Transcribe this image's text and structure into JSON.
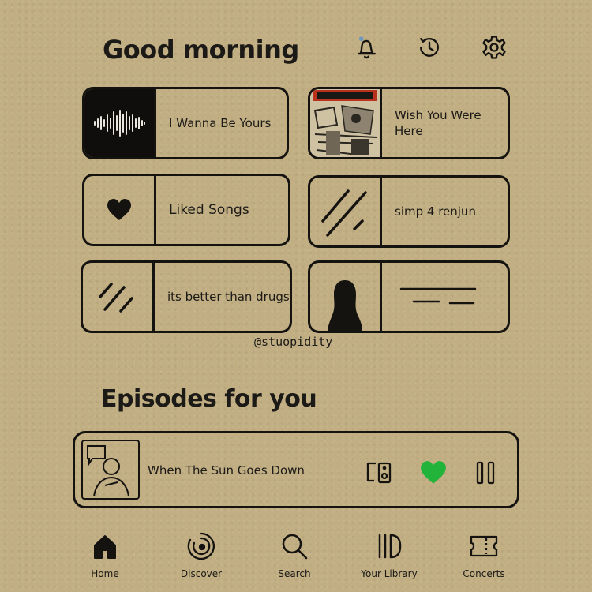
{
  "header": {
    "greeting": "Good morning",
    "icons": [
      "bell-icon",
      "history-icon",
      "gear-icon"
    ],
    "notification_dot_color": "#6f99bf"
  },
  "quick_picks": [
    {
      "label": "I Wanna Be Yours",
      "art": "soundwave"
    },
    {
      "label": "Wish You Were Here",
      "art": "album-cover"
    },
    {
      "label": "Liked Songs",
      "art": "heart"
    },
    {
      "label": "simp 4 renjun",
      "art": "strokes"
    },
    {
      "label": "its better than drugs",
      "art": "strokes"
    },
    {
      "label": "",
      "art": "silhouette"
    }
  ],
  "watermark": "@stuopidity",
  "episodes": {
    "title": "Episodes for you",
    "current": {
      "title": "When The Sun Goes Down",
      "liked": true
    }
  },
  "colors": {
    "accent": "#22b33a",
    "ink": "#151310",
    "background": "#c1ae83"
  },
  "nav": [
    {
      "label": "Home",
      "icon": "home-icon",
      "active": true
    },
    {
      "label": "Discover",
      "icon": "discover-icon"
    },
    {
      "label": "Search",
      "icon": "search-icon"
    },
    {
      "label": "Your Library",
      "icon": "library-icon"
    },
    {
      "label": "Concerts",
      "icon": "ticket-icon"
    }
  ]
}
